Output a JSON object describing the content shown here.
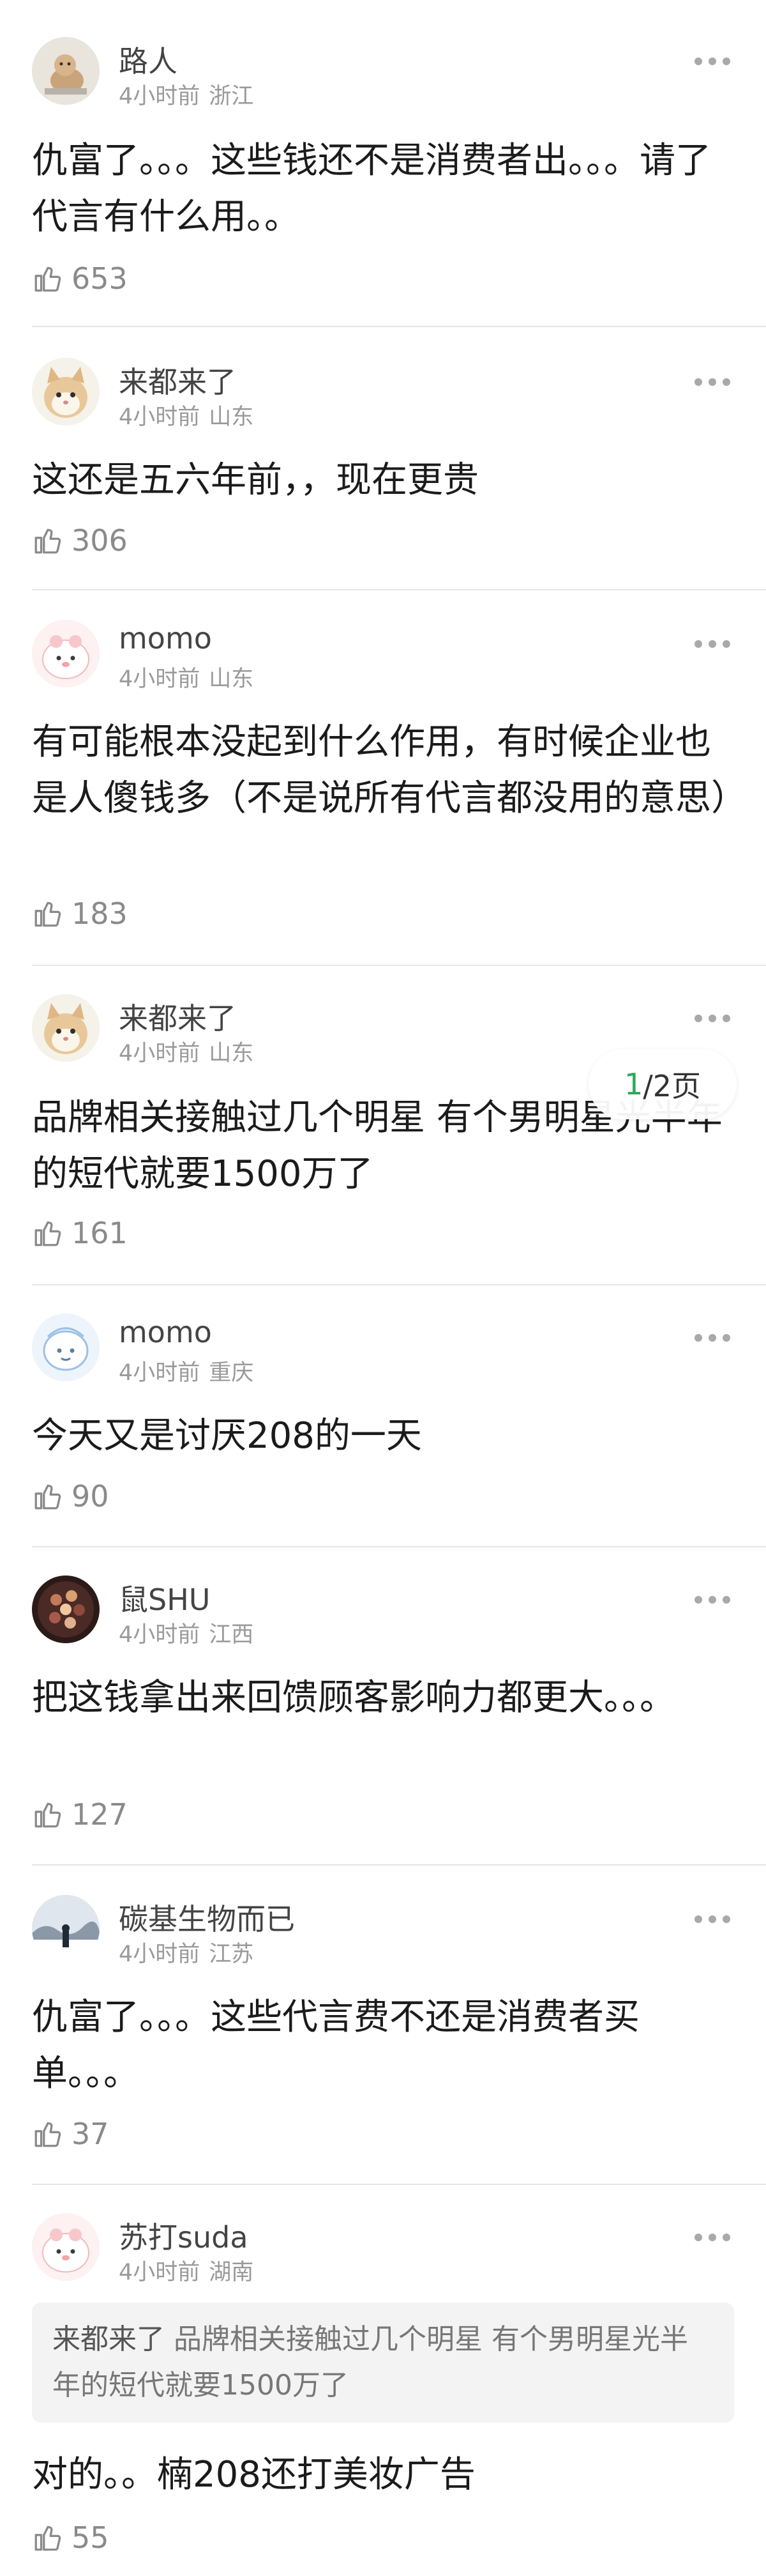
{
  "comments": [
    {
      "name": "路人",
      "time": "4小时前",
      "location": "浙江",
      "text": "仇富了。。。这些钱还不是消费者出。。。请了代言有什么用。。",
      "likes": "653"
    },
    {
      "name": "来都来了",
      "time": "4小时前",
      "location": "山东",
      "text": "这还是五六年前，，现在更贵",
      "likes": "306"
    },
    {
      "name": "momo",
      "time": "4小时前",
      "location": "山东",
      "text": "有可能根本没起到什么作用，有时候企业也是人傻钱多（不是说所有代言都没用的意思）",
      "likes": "183"
    },
    {
      "name": "来都来了",
      "time": "4小时前",
      "location": "山东",
      "text": "品牌相关接触过几个明星 有个男明星光半年的短代就要1500万了",
      "likes": "161"
    },
    {
      "name": "momo",
      "time": "4小时前",
      "location": "重庆",
      "text": "今天又是讨厌208的一天",
      "likes": "90"
    },
    {
      "name": "鼠SHU",
      "time": "4小时前",
      "location": "江西",
      "text": "把这钱拿出来回馈顾客影响力都更大。。。",
      "likes": "127"
    },
    {
      "name": "碳基生物而已",
      "time": "4小时前",
      "location": "江苏",
      "text": "仇富了。。。这些代言费不还是消费者买单。。。",
      "likes": "37"
    },
    {
      "name": "苏打suda",
      "time": "4小时前",
      "location": "湖南",
      "quote_name": "来都来了",
      "quote_text": "品牌相关接触过几个明星 有个男明星光半年的短代就要1500万了",
      "text": "对的。。楠208还打美妆广告",
      "likes": "55"
    }
  ],
  "pager": {
    "current": "1",
    "rest": "/2页"
  },
  "colors": {
    "accent_green": "#2aa85a",
    "divider": "#e6e6e6",
    "meta_gray": "#9a9a9a"
  }
}
